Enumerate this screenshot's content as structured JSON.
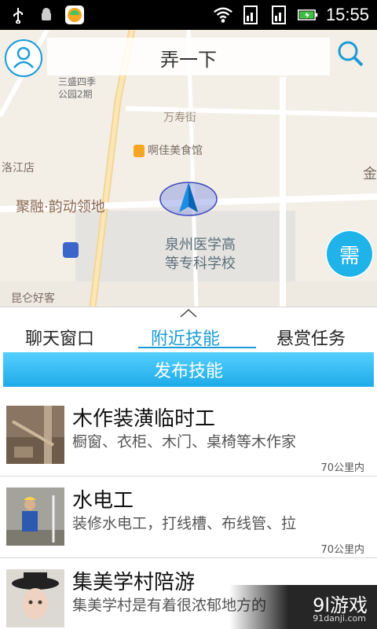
{
  "status_bar": {
    "time": "15:55"
  },
  "map": {
    "search_title": "弄一下",
    "labels": {
      "park": "三盛四季\n公园2期",
      "road_top": "万寿街",
      "restaurant": "啊佳美食馆",
      "store": "洛江店",
      "district": "聚融·韵动领地",
      "school": "泉州医学高\n等专科学校",
      "kunlun": "昆仑好客",
      "right_edge": "金"
    },
    "need_button": "需"
  },
  "tabs": [
    {
      "label": "聊天窗口"
    },
    {
      "label": "附近技能"
    },
    {
      "label": "悬赏任务"
    }
  ],
  "publish_button": "发布技能",
  "list": [
    {
      "title": "木作装潢临时工",
      "desc": "橱窗、衣柜、木门、桌椅等木作家",
      "distance": "70公里内"
    },
    {
      "title": "水电工",
      "desc": "装修水电工，打线槽、布线管、拉",
      "distance": "70公里内"
    },
    {
      "title": "集美学村陪游",
      "desc": "集美学村是有着很浓郁地方的",
      "distance": ""
    }
  ],
  "watermark": {
    "main": "9l游戏",
    "sub": "91danji.com"
  },
  "colors": {
    "accent": "#1a9bd7",
    "publish": "#1eaae8",
    "map_bg": "#f3efe7"
  }
}
